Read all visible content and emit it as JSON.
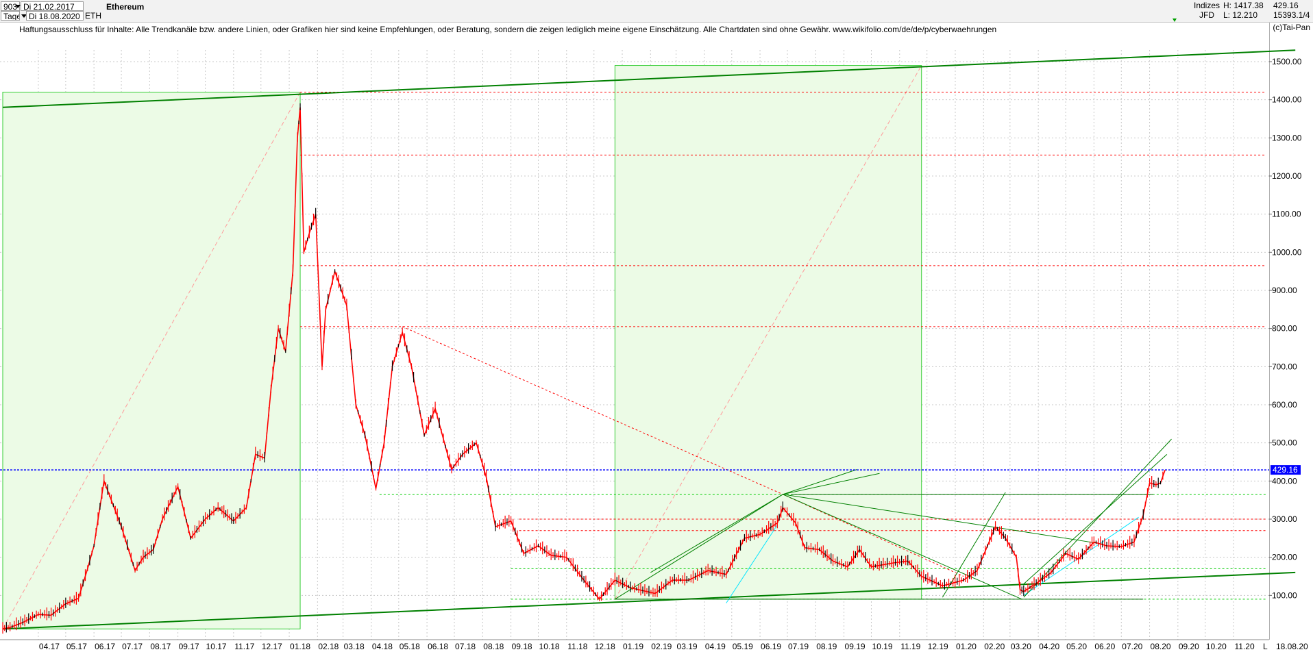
{
  "header": {
    "symbol_code": "903",
    "start_label": "Di 21.02.2017",
    "interval": "Tage",
    "end_label": "Di 18.08.2020",
    "ticker": "ETH",
    "title": "Ethereum",
    "category": "Indizes",
    "high_label": "H: 1417.38",
    "last_value": "429.16",
    "exchange": "JFD",
    "low_label": "L: 12.210",
    "index_value": "15393.1/4"
  },
  "disclaimer": "Haftungsausschluss für Inhalte: Alle Trendkanäle bzw. andere Linien, oder Grafiken hier sind keine Empfehlungen, oder Beratung, sondern die zeigen lediglich meine eigene Einschätzung. Alle Chartdaten sind ohne Gewähr.  www.wikifolio.com/de/de/p/cyberwaehrungen",
  "copyright": "(c)Tai-Pan",
  "colors": {
    "candle_up": "#000000",
    "candle_down": "#ff0000",
    "current_price_line": "#0000ff",
    "trend_line": "#008000",
    "channel_fill": "#ecfbe6",
    "resistance_line": "#ff0000",
    "support_line": "#00cc00",
    "cyan_line": "#00e5ff"
  },
  "chart_data": {
    "type": "candlestick",
    "title": "Ethereum",
    "ylim": [
      12.21,
      1550
    ],
    "yticks": [
      100,
      200,
      300,
      400,
      500,
      600,
      700,
      800,
      900,
      1000,
      1100,
      1200,
      1300,
      1400,
      1500
    ],
    "ytick_labels": [
      "100.00",
      "200.00",
      "300.00",
      "400.00",
      "500.00",
      "600.00",
      "700.00",
      "800.00",
      "900.00",
      "1000.00",
      "1100.00",
      "1200.00",
      "1300.00",
      "1400.00",
      "1500.00"
    ],
    "xticks": [
      "04.17",
      "05.17",
      "06.17",
      "07.17",
      "08.17",
      "09.17",
      "10.17",
      "11.17",
      "12.17",
      "01.18",
      "02.18",
      "03.18",
      "04.18",
      "05.18",
      "06.18",
      "07.18",
      "08.18",
      "09.18",
      "10.18",
      "11.18",
      "12.18",
      "01.19",
      "02.19",
      "03.19",
      "04.19",
      "05.19",
      "06.19",
      "07.19",
      "08.19",
      "09.19",
      "10.19",
      "11.19",
      "12.19",
      "01.20",
      "02.20",
      "03.20",
      "04.20",
      "05.20",
      "06.20",
      "07.20",
      "08.20",
      "09.20",
      "10.20",
      "11.20"
    ],
    "x_end_label": "18.08.20",
    "x_axis_marker": "L",
    "current_price": 429.16,
    "current_price_label": "429.16",
    "series": [
      {
        "date": "2017-02-21",
        "close": 12.2
      },
      {
        "date": "2017-03-01",
        "close": 16
      },
      {
        "date": "2017-03-15",
        "close": 29
      },
      {
        "date": "2017-04-01",
        "close": 50
      },
      {
        "date": "2017-04-15",
        "close": 48
      },
      {
        "date": "2017-05-01",
        "close": 78
      },
      {
        "date": "2017-05-15",
        "close": 92
      },
      {
        "date": "2017-05-25",
        "close": 170
      },
      {
        "date": "2017-06-01",
        "close": 230
      },
      {
        "date": "2017-06-12",
        "close": 400
      },
      {
        "date": "2017-06-20",
        "close": 350
      },
      {
        "date": "2017-07-01",
        "close": 280
      },
      {
        "date": "2017-07-16",
        "close": 165
      },
      {
        "date": "2017-07-25",
        "close": 200
      },
      {
        "date": "2017-08-05",
        "close": 220
      },
      {
        "date": "2017-08-15",
        "close": 300
      },
      {
        "date": "2017-09-01",
        "close": 385
      },
      {
        "date": "2017-09-15",
        "close": 250
      },
      {
        "date": "2017-10-01",
        "close": 300
      },
      {
        "date": "2017-10-15",
        "close": 330
      },
      {
        "date": "2017-11-01",
        "close": 295
      },
      {
        "date": "2017-11-15",
        "close": 330
      },
      {
        "date": "2017-11-25",
        "close": 470
      },
      {
        "date": "2017-12-05",
        "close": 460
      },
      {
        "date": "2017-12-12",
        "close": 640
      },
      {
        "date": "2017-12-20",
        "close": 800
      },
      {
        "date": "2017-12-28",
        "close": 740
      },
      {
        "date": "2018-01-05",
        "close": 950
      },
      {
        "date": "2018-01-10",
        "close": 1300
      },
      {
        "date": "2018-01-13",
        "close": 1380
      },
      {
        "date": "2018-01-17",
        "close": 1000
      },
      {
        "date": "2018-01-23",
        "close": 1050
      },
      {
        "date": "2018-01-30",
        "close": 1100
      },
      {
        "date": "2018-02-06",
        "close": 700
      },
      {
        "date": "2018-02-10",
        "close": 850
      },
      {
        "date": "2018-02-20",
        "close": 950
      },
      {
        "date": "2018-03-05",
        "close": 860
      },
      {
        "date": "2018-03-15",
        "close": 600
      },
      {
        "date": "2018-03-25",
        "close": 520
      },
      {
        "date": "2018-04-06",
        "close": 380
      },
      {
        "date": "2018-04-15",
        "close": 500
      },
      {
        "date": "2018-04-24",
        "close": 700
      },
      {
        "date": "2018-05-05",
        "close": 790
      },
      {
        "date": "2018-05-15",
        "close": 700
      },
      {
        "date": "2018-05-29",
        "close": 520
      },
      {
        "date": "2018-06-10",
        "close": 590
      },
      {
        "date": "2018-06-28",
        "close": 430
      },
      {
        "date": "2018-07-10",
        "close": 470
      },
      {
        "date": "2018-07-25",
        "close": 500
      },
      {
        "date": "2018-08-05",
        "close": 410
      },
      {
        "date": "2018-08-15",
        "close": 280
      },
      {
        "date": "2018-09-01",
        "close": 295
      },
      {
        "date": "2018-09-15",
        "close": 210
      },
      {
        "date": "2018-10-01",
        "close": 230
      },
      {
        "date": "2018-10-15",
        "close": 205
      },
      {
        "date": "2018-11-01",
        "close": 200
      },
      {
        "date": "2018-11-20",
        "close": 140
      },
      {
        "date": "2018-12-07",
        "close": 90
      },
      {
        "date": "2018-12-24",
        "close": 140
      },
      {
        "date": "2019-01-10",
        "close": 120
      },
      {
        "date": "2019-02-06",
        "close": 105
      },
      {
        "date": "2019-02-25",
        "close": 140
      },
      {
        "date": "2019-03-15",
        "close": 140
      },
      {
        "date": "2019-04-05",
        "close": 165
      },
      {
        "date": "2019-04-25",
        "close": 155
      },
      {
        "date": "2019-05-15",
        "close": 250
      },
      {
        "date": "2019-06-01",
        "close": 260
      },
      {
        "date": "2019-06-20",
        "close": 290
      },
      {
        "date": "2019-06-26",
        "close": 330
      },
      {
        "date": "2019-07-10",
        "close": 290
      },
      {
        "date": "2019-07-20",
        "close": 225
      },
      {
        "date": "2019-08-05",
        "close": 220
      },
      {
        "date": "2019-08-20",
        "close": 190
      },
      {
        "date": "2019-09-05",
        "close": 175
      },
      {
        "date": "2019-09-18",
        "close": 220
      },
      {
        "date": "2019-10-01",
        "close": 175
      },
      {
        "date": "2019-10-25",
        "close": 185
      },
      {
        "date": "2019-11-10",
        "close": 190
      },
      {
        "date": "2019-11-25",
        "close": 150
      },
      {
        "date": "2019-12-18",
        "close": 125
      },
      {
        "date": "2020-01-10",
        "close": 140
      },
      {
        "date": "2020-01-25",
        "close": 165
      },
      {
        "date": "2020-02-14",
        "close": 280
      },
      {
        "date": "2020-02-25",
        "close": 250
      },
      {
        "date": "2020-03-08",
        "close": 200
      },
      {
        "date": "2020-03-12",
        "close": 115
      },
      {
        "date": "2020-03-16",
        "close": 110
      },
      {
        "date": "2020-04-01",
        "close": 135
      },
      {
        "date": "2020-04-15",
        "close": 160
      },
      {
        "date": "2020-05-01",
        "close": 210
      },
      {
        "date": "2020-05-15",
        "close": 195
      },
      {
        "date": "2020-06-01",
        "close": 240
      },
      {
        "date": "2020-06-15",
        "close": 230
      },
      {
        "date": "2020-07-01",
        "close": 228
      },
      {
        "date": "2020-07-15",
        "close": 240
      },
      {
        "date": "2020-07-25",
        "close": 310
      },
      {
        "date": "2020-08-01",
        "close": 395
      },
      {
        "date": "2020-08-08",
        "close": 390
      },
      {
        "date": "2020-08-13",
        "close": 395
      },
      {
        "date": "2020-08-18",
        "close": 429.16
      }
    ],
    "annotations": {
      "resistance_levels": [
        1420,
        1255,
        965,
        805,
        300,
        270
      ],
      "support_levels": [
        365,
        170,
        90
      ],
      "trend_channel_top": [
        {
          "date": "2017-02-21",
          "value": 1380
        },
        {
          "date": "2020-08-18",
          "value": 1530
        }
      ],
      "trend_channel_bottom": [
        {
          "date": "2017-02-21",
          "value": 12
        },
        {
          "date": "2020-08-18",
          "value": 160
        }
      ],
      "shaded_zones": [
        {
          "from": "2017-02-21",
          "to": "2018-01-13",
          "low": 12,
          "high": 1420
        },
        {
          "from": "2018-12-24",
          "to": "2019-11-25",
          "low": 90,
          "high": 1490
        }
      ]
    }
  }
}
